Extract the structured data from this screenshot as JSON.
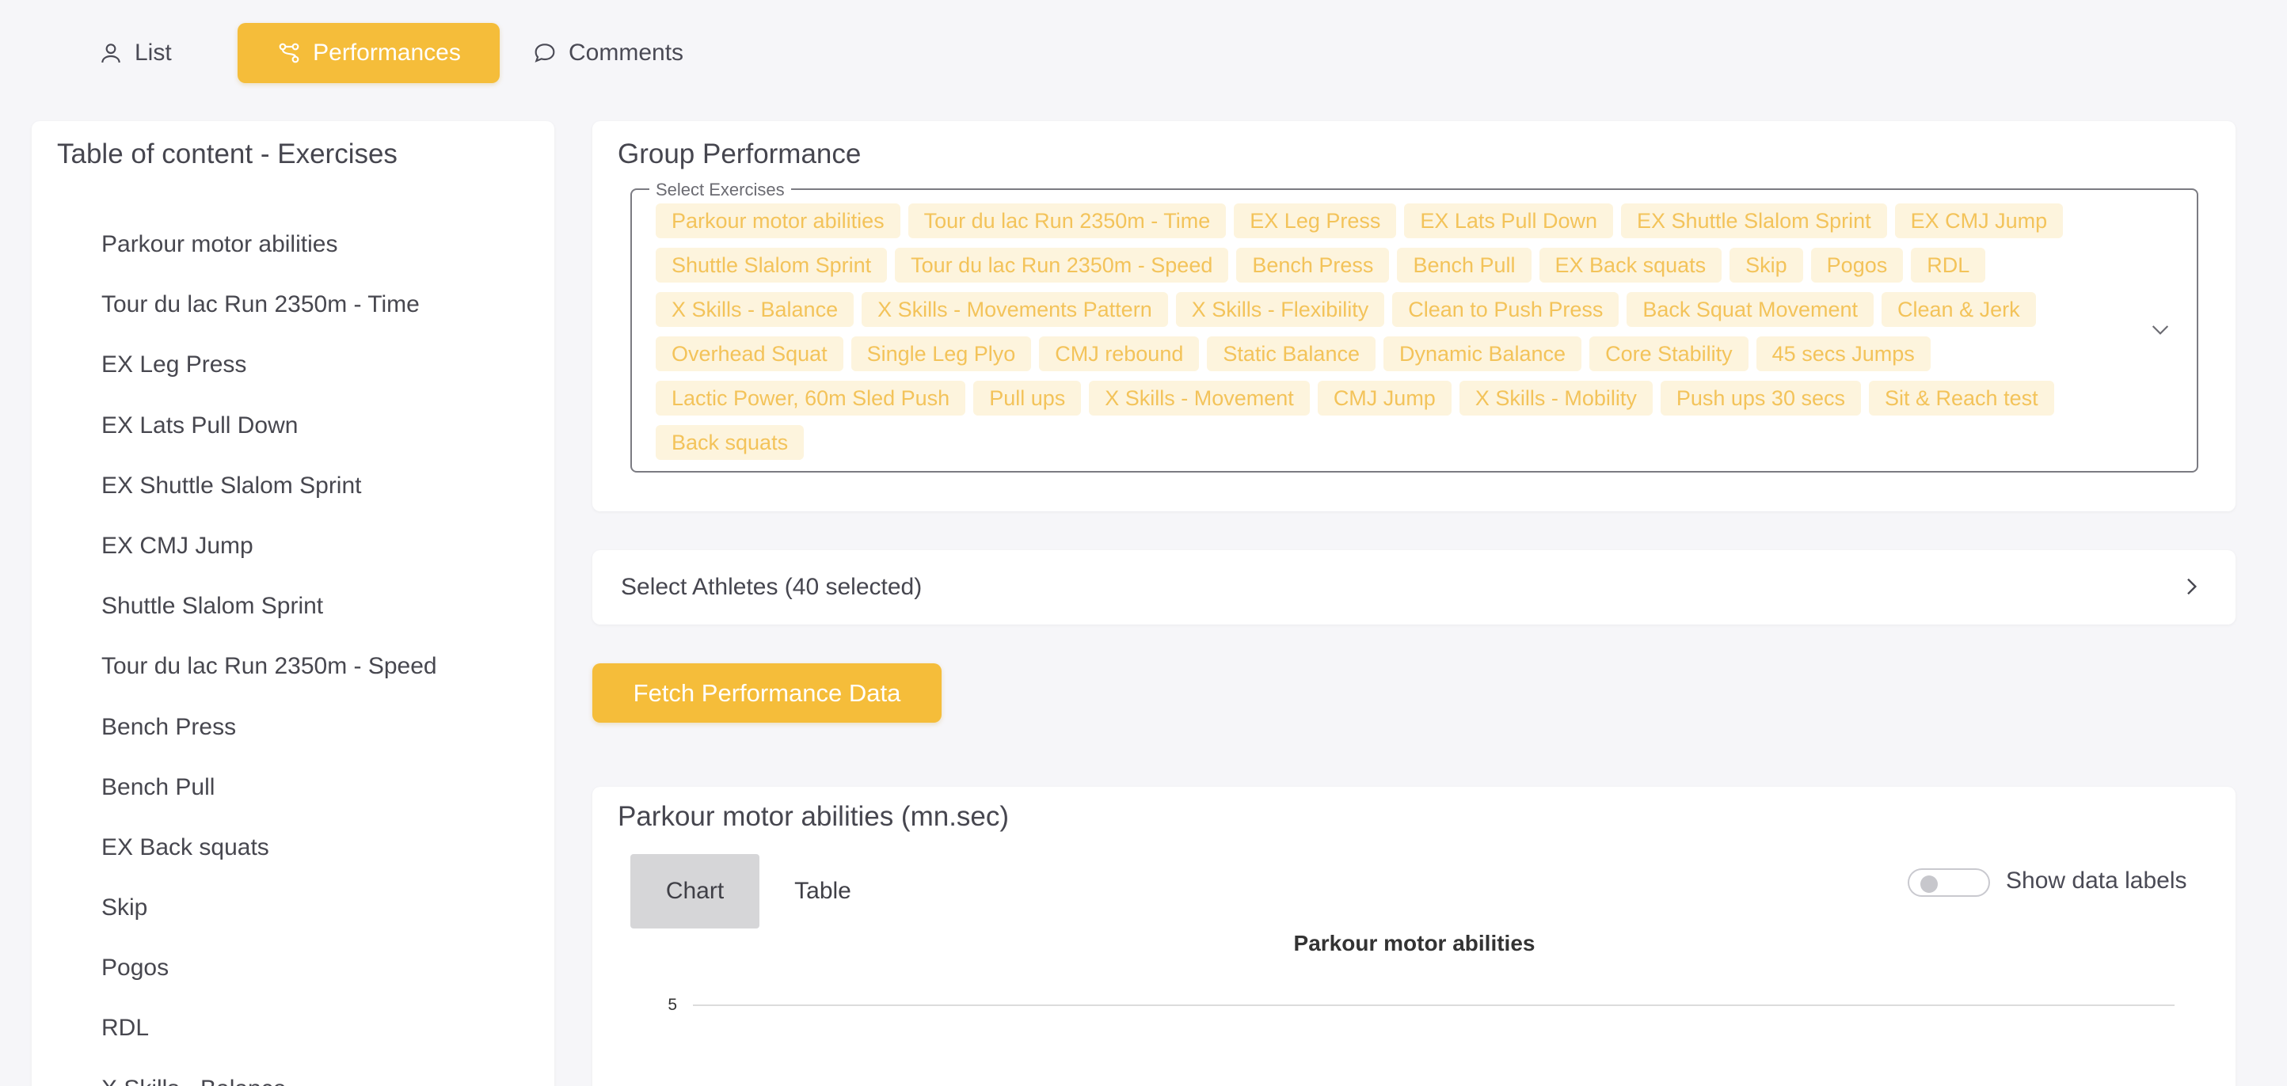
{
  "nav": {
    "list": "List",
    "performances": "Performances",
    "comments": "Comments",
    "accent": "#f5bd3a"
  },
  "sidebar": {
    "title": "Table of content - Exercises",
    "items": [
      "Parkour motor abilities",
      "Tour du lac Run 2350m - Time",
      "EX Leg Press",
      "EX Lats Pull Down",
      "EX Shuttle Slalom Sprint",
      "EX CMJ Jump",
      "Shuttle Slalom Sprint",
      "Tour du lac Run 2350m - Speed",
      "Bench Press",
      "Bench Pull",
      "EX Back squats",
      "Skip",
      "Pogos",
      "RDL",
      "X Skills - Balance"
    ]
  },
  "group_performance": {
    "title": "Group Performance",
    "select_label": "Select Exercises",
    "chips": [
      "Parkour motor abilities",
      "Tour du lac Run 2350m - Time",
      "EX Leg Press",
      "EX Lats Pull Down",
      "EX Shuttle Slalom Sprint",
      "EX CMJ Jump",
      "Shuttle Slalom Sprint",
      "Tour du lac Run 2350m - Speed",
      "Bench Press",
      "Bench Pull",
      "EX Back squats",
      "Skip",
      "Pogos",
      "RDL",
      "X Skills - Balance",
      "X Skills - Movements Pattern",
      "X Skills - Flexibility",
      "Clean to Push Press",
      "Back Squat Movement",
      "Clean & Jerk",
      "Overhead Squat",
      "Single Leg Plyo",
      "CMJ rebound",
      "Static Balance",
      "Dynamic Balance",
      "Core Stability",
      "45 secs Jumps",
      "Lactic Power, 60m Sled Push",
      "Pull ups",
      "X Skills - Movement",
      "CMJ Jump",
      "X Skills - Mobility",
      "Push ups 30 secs",
      "Sit & Reach test",
      "Back squats"
    ]
  },
  "athletes": {
    "label": "Select Athletes (40 selected)"
  },
  "fetch_button": "Fetch Performance Data",
  "chart_section": {
    "title": "Parkour motor abilities (mn.sec)",
    "tab_chart": "Chart",
    "tab_table": "Table",
    "toggle_label": "Show data labels",
    "toggle_on": false
  },
  "chart_data": {
    "type": "bar",
    "title": "Parkour motor abilities",
    "ytick_visible": "5",
    "xlabel": "",
    "ylabel": ""
  }
}
